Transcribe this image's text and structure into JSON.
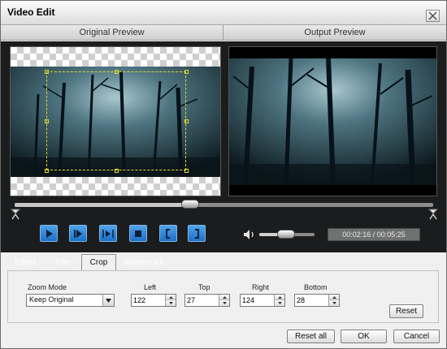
{
  "window": {
    "title": "Video Edit"
  },
  "preview": {
    "original_label": "Original Preview",
    "output_label": "Output Preview"
  },
  "playback": {
    "time": "00:02:16 / 00:05:25",
    "position_fraction": 0.4185,
    "volume_fraction": 0.49
  },
  "tabs": [
    {
      "label": "Effect",
      "active": false
    },
    {
      "label": "Trim",
      "active": false
    },
    {
      "label": "Crop",
      "active": true
    },
    {
      "label": "Watermark",
      "active": false
    }
  ],
  "crop": {
    "zoom_mode_label": "Zoom Mode",
    "zoom_mode_value": "Keep Original",
    "left_label": "Left",
    "left_value": "122",
    "top_label": "Top",
    "top_value": "27",
    "right_label": "Right",
    "right_value": "124",
    "bottom_label": "Bottom",
    "bottom_value": "28",
    "reset_label": "Reset"
  },
  "footer": {
    "reset_all_label": "Reset all",
    "ok_label": "OK",
    "cancel_label": "Cancel"
  },
  "colors": {
    "control_blue": "#1c6fc5",
    "crop_guide": "#e5d62c",
    "dark_bg": "#1b1c1d"
  }
}
